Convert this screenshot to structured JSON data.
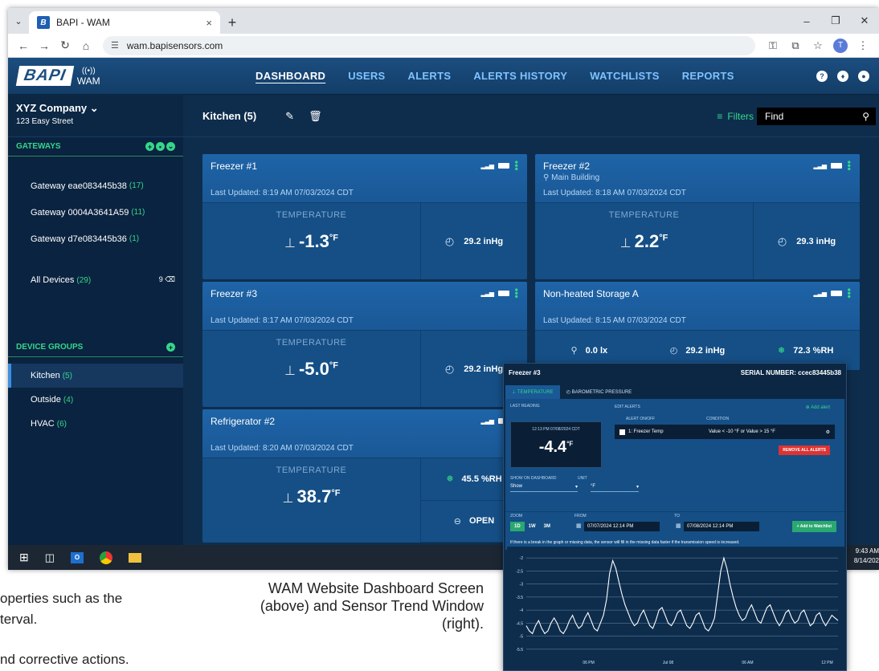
{
  "browser": {
    "tab_title": "BAPI - WAM",
    "favicon_text": "B",
    "url": "wam.bapisensors.com",
    "profile_initial": "T"
  },
  "app": {
    "logo": "BAPI",
    "logo_sub": "WAM",
    "nav": [
      {
        "label": "DASHBOARD",
        "active": true
      },
      {
        "label": "USERS"
      },
      {
        "label": "ALERTS"
      },
      {
        "label": "ALERTS HISTORY"
      },
      {
        "label": "WATCHLISTS"
      },
      {
        "label": "REPORTS"
      }
    ]
  },
  "sidebar": {
    "company": "XYZ Company",
    "address": "123 Easy Street",
    "gateways_header": "GATEWAYS",
    "gateways": [
      {
        "name": "Gateway eae083445b38",
        "count": "(17)"
      },
      {
        "name": "Gateway 0004A3641A59",
        "count": "(11)"
      },
      {
        "name": "Gateway d7e083445b36",
        "count": "(1)"
      }
    ],
    "all_devices": {
      "name": "All Devices",
      "count": "(29)",
      "badge": "9"
    },
    "groups_header": "DEVICE GROUPS",
    "groups": [
      {
        "name": "Kitchen",
        "count": "(5)",
        "active": true
      },
      {
        "name": "Outside",
        "count": "(4)"
      },
      {
        "name": "HVAC",
        "count": "(6)"
      }
    ]
  },
  "main": {
    "group_title": "Kitchen (5)",
    "filters_label": "Filters",
    "find_placeholder": "Find",
    "cards": [
      {
        "name": "Freezer #1",
        "location": "",
        "updated": "Last Updated: 8:19 AM 07/03/2024 CDT",
        "temp_label": "TEMPERATURE",
        "temp": "-1.3",
        "unit": "°F",
        "pressure": "29.2 inHg"
      },
      {
        "name": "Freezer #2",
        "location": "Main Building",
        "updated": "Last Updated: 8:18 AM 07/03/2024 CDT",
        "temp_label": "TEMPERATURE",
        "temp": "2.2",
        "unit": "°F",
        "pressure": "29.3 inHg"
      },
      {
        "name": "Freezer #3",
        "location": "",
        "updated": "Last Updated: 8:17 AM 07/03/2024 CDT",
        "temp_label": "TEMPERATURE",
        "temp": "-5.0",
        "unit": "°F",
        "pressure": "29.2 inHg"
      },
      {
        "name": "Non-heated Storage A",
        "location": "",
        "updated": "Last Updated: 8:15 AM 07/03/2024 CDT",
        "light": "0.0 lx",
        "pressure": "29.2 inHg",
        "humidity": "72.3 %RH"
      },
      {
        "name": "Refrigerator #2",
        "location": "",
        "updated": "Last Updated: 8:20 AM 07/03/2024 CDT",
        "temp_label": "TEMPERATURE",
        "temp": "38.7",
        "unit": "°F",
        "humidity": "45.5 %RH",
        "door": "OPEN"
      }
    ]
  },
  "taskbar": {
    "time": "9:43 AM",
    "date": "8/14/202"
  },
  "captions": {
    "left_line1": "operties such as the",
    "left_line2": "terval.",
    "left_line3": "nd corrective actions.",
    "center": "WAM Website Dashboard Screen (above) and Sensor Trend Window (right)."
  },
  "trend_window": {
    "title": "Freezer #3",
    "serial": "SERIAL NUMBER: ccec83445b38",
    "tabs": [
      "TEMPERATURE",
      "BAROMETRIC PRESSURE"
    ],
    "last_reading_label": "LAST READING",
    "last_reading_time": "12:13 PM 07/08/2024 CDT",
    "last_reading_value": "-4.4",
    "last_reading_unit": "°F",
    "edit_alerts_label": "EDIT ALERTS",
    "add_alert": "Add alert",
    "alert_col1": "ALERT ON/OFF",
    "alert_col2": "CONDITION",
    "alert_name": "1: Freezer Temp",
    "alert_condition": "Value < -10 °F or Value > 15 °F",
    "remove_all": "REMOVE ALL ALERTS",
    "show_on_dash_label": "SHOW ON DASHBOARD",
    "show_on_dash_value": "Show",
    "unit_label": "UNIT",
    "unit_value": "°F",
    "zoom_label": "ZOOM",
    "zoom_options": [
      "1D",
      "1W",
      "3M"
    ],
    "from_label": "FROM",
    "from_value": "07/07/2024 12:14 PM",
    "to_label": "TO",
    "to_value": "07/08/2024 12:14 PM",
    "add_watchlist": "+ Add to Watchlist",
    "note": "If there is a break in the graph or missing data, the sensor will fill in the missing data faster if the transmission speed is increased."
  },
  "chart_data": {
    "type": "line",
    "y_ticks": [
      "-2",
      "-2.5",
      "-3",
      "-3.5",
      "-4",
      "-4.5",
      "-5",
      "-5.5"
    ],
    "ylim": [
      -5.75,
      -1.75
    ],
    "x_ticks": [
      "06 PM",
      "Jul 08",
      "06 AM",
      "12 PM"
    ],
    "series": [
      {
        "values": [
          -4.6,
          -4.8,
          -4.9,
          -4.6,
          -4.4,
          -4.7,
          -4.9,
          -4.8,
          -4.5,
          -4.3,
          -4.5,
          -4.8,
          -4.9,
          -4.7,
          -4.4,
          -4.2,
          -4.5,
          -4.7,
          -4.6,
          -4.3,
          -4.1,
          -4.4,
          -4.7,
          -4.8,
          -4.5,
          -4.2,
          -3.6,
          -2.6,
          -2.1,
          -2.4,
          -2.9,
          -3.4,
          -3.8,
          -4.1,
          -4.4,
          -4.6,
          -4.5,
          -4.2,
          -4.0,
          -4.3,
          -4.6,
          -4.7,
          -4.4,
          -4.0,
          -3.9,
          -4.2,
          -4.5,
          -4.6,
          -4.4,
          -4.1,
          -4.0,
          -4.3,
          -4.6,
          -4.7,
          -4.5,
          -4.2,
          -4.1,
          -4.4,
          -4.7,
          -4.8,
          -4.6,
          -4.3,
          -3.4,
          -2.5,
          -2.0,
          -2.4,
          -3.0,
          -3.5,
          -3.9,
          -4.2,
          -4.4,
          -4.3,
          -4.0,
          -3.8,
          -4.1,
          -4.4,
          -4.5,
          -4.2,
          -3.9,
          -3.8,
          -4.1,
          -4.4,
          -4.6,
          -4.4,
          -4.1,
          -4.0,
          -4.3,
          -4.5,
          -4.4,
          -4.1,
          -4.0,
          -4.3,
          -4.6,
          -4.5,
          -4.2,
          -4.1,
          -4.4,
          -4.6,
          -4.4,
          -4.2,
          -4.3,
          -4.4
        ]
      }
    ]
  },
  "colors": {
    "accent_green": "#36d68a",
    "nav_link": "#7fc2ff",
    "card_bg": "#154f86",
    "page_bg": "#0e2d4d"
  }
}
